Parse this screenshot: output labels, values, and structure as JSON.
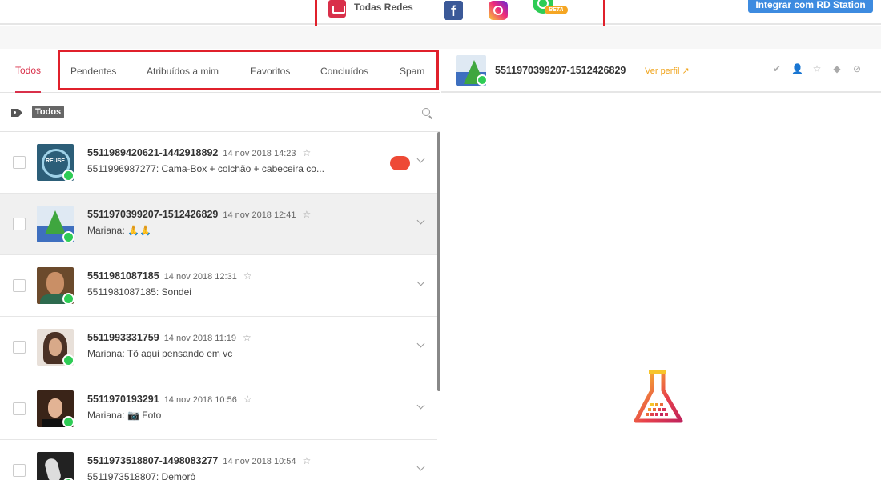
{
  "networks": {
    "all_label": "Todas Redes",
    "beta_badge": "BETA",
    "items": [
      {
        "icon": "inbox-icon",
        "label": "Todas Redes"
      },
      {
        "icon": "facebook-icon"
      },
      {
        "icon": "instagram-icon"
      },
      {
        "icon": "whatsapp-icon",
        "badge": "BETA",
        "active": true
      }
    ]
  },
  "integrate_button": "Integrar com RD Station",
  "filter_tabs": [
    {
      "label": "Todos",
      "active": true
    },
    {
      "label": "Pendentes"
    },
    {
      "label": "Atribuídos a mim"
    },
    {
      "label": "Favoritos"
    },
    {
      "label": "Concluídos"
    },
    {
      "label": "Spam"
    }
  ],
  "tag_filter": {
    "icon": "tag-icon",
    "chip": "Todos",
    "search_icon": "search-icon"
  },
  "conversations": [
    {
      "name": "5511989420621-1442918892",
      "date": "14 nov 2018 14:23",
      "preview": "5511996987277: Cama-Box + colchão + cabeceira co...",
      "avatar": "reuse-logo",
      "avatar_text": "REUSE",
      "unread_dot": true,
      "selected": false
    },
    {
      "name": "5511970399207-1512426829",
      "date": "14 nov 2018 12:41",
      "preview": "Mariana: 🙏🙏",
      "avatar": "tree-photo",
      "selected": true
    },
    {
      "name": "5511981087185",
      "date": "14 nov 2018 12:31",
      "preview": "5511981087185: Sondei",
      "avatar": "man-photo",
      "selected": false
    },
    {
      "name": "5511993331759",
      "date": "14 nov 2018 11:19",
      "preview": "Mariana: Tô aqui pensando em vc",
      "avatar": "woman-photo",
      "selected": false
    },
    {
      "name": "5511970193291",
      "date": "14 nov 2018 10:56",
      "preview": "Mariana: 📷 Foto",
      "avatar": "woman-photo-2",
      "selected": false
    },
    {
      "name": "5511973518807-1498083277",
      "date": "14 nov 2018 10:54",
      "preview": "5511973518807: Demorô",
      "avatar": "bw-photo",
      "selected": false
    }
  ],
  "detail": {
    "name": "5511970399207-1512426829",
    "profile_link": "Ver perfil",
    "actions": [
      "check-icon",
      "assign-user-icon",
      "star-icon",
      "tag-icon",
      "block-icon"
    ]
  },
  "colors": {
    "accent": "#d9304a",
    "highlight": "#e0202b",
    "whatsapp": "#2ecc55",
    "link": "#f0a41c",
    "button": "#3d8be0"
  }
}
